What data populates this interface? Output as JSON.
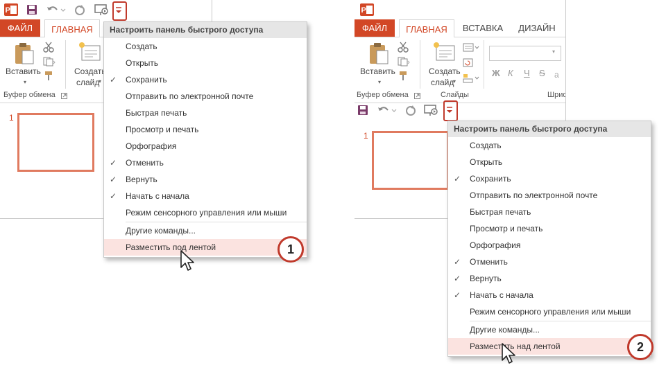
{
  "colors": {
    "accent": "#d24726",
    "highlight": "#fbe3e0",
    "callout": "#c0392b"
  },
  "icons": [
    "powerpoint-logo-icon",
    "save-icon",
    "undo-icon",
    "redo-icon",
    "present-icon",
    "customize-qat-arrow-icon",
    "paste-icon",
    "cut-icon",
    "copy-icon",
    "format-painter-icon",
    "new-slide-icon",
    "check-icon",
    "mouse-pointer-icon"
  ],
  "before": {
    "tabs": {
      "file": "ФАЙЛ",
      "home": "ГЛАВНАЯ"
    },
    "ribbon": {
      "paste": "Вставить",
      "new_slide_1": "Создать",
      "new_slide_2": "слайд",
      "clipboard_group": "Буфер обмена"
    },
    "slide_number": "1",
    "menu": {
      "header": "Настроить панель быстрого доступа",
      "items": [
        {
          "label": "Создать",
          "checked": ""
        },
        {
          "label": "Открыть",
          "checked": ""
        },
        {
          "label": "Сохранить",
          "checked": "✓"
        },
        {
          "label": "Отправить по электронной почте",
          "checked": ""
        },
        {
          "label": "Быстрая печать",
          "checked": ""
        },
        {
          "label": "Просмотр и печать",
          "checked": ""
        },
        {
          "label": "Орфография",
          "checked": ""
        },
        {
          "label": "Отменить",
          "checked": "✓"
        },
        {
          "label": "Вернуть",
          "checked": "✓"
        },
        {
          "label": "Начать с начала",
          "checked": "✓"
        },
        {
          "label": "Режим сенсорного управления или мыши",
          "checked": ""
        }
      ],
      "more_commands": "Другие команды...",
      "placement": "Разместить под лентой"
    },
    "step": "1"
  },
  "after": {
    "tabs": {
      "file": "ФАЙЛ",
      "home": "ГЛАВНАЯ",
      "insert": "ВСТАВКА",
      "design": "ДИЗАЙН"
    },
    "ribbon": {
      "paste": "Вставить",
      "new_slide_1": "Создать",
      "new_slide_2": "слайд",
      "clipboard_group": "Буфер обмена",
      "slides_group": "Слайды",
      "font_group": "Шриф",
      "bold": "Ж",
      "italic": "К",
      "underline": "Ч",
      "strike": "S"
    },
    "slide_number": "1",
    "menu": {
      "header": "Настроить панель быстрого доступа",
      "items": [
        {
          "label": "Создать",
          "checked": ""
        },
        {
          "label": "Открыть",
          "checked": ""
        },
        {
          "label": "Сохранить",
          "checked": "✓"
        },
        {
          "label": "Отправить по электронной почте",
          "checked": ""
        },
        {
          "label": "Быстрая печать",
          "checked": ""
        },
        {
          "label": "Просмотр и печать",
          "checked": ""
        },
        {
          "label": "Орфография",
          "checked": ""
        },
        {
          "label": "Отменить",
          "checked": "✓"
        },
        {
          "label": "Вернуть",
          "checked": "✓"
        },
        {
          "label": "Начать с начала",
          "checked": "✓"
        },
        {
          "label": "Режим сенсорного управления или мыши",
          "checked": ""
        }
      ],
      "more_commands": "Другие команды...",
      "placement": "Разместить над лентой"
    },
    "step": "2"
  }
}
